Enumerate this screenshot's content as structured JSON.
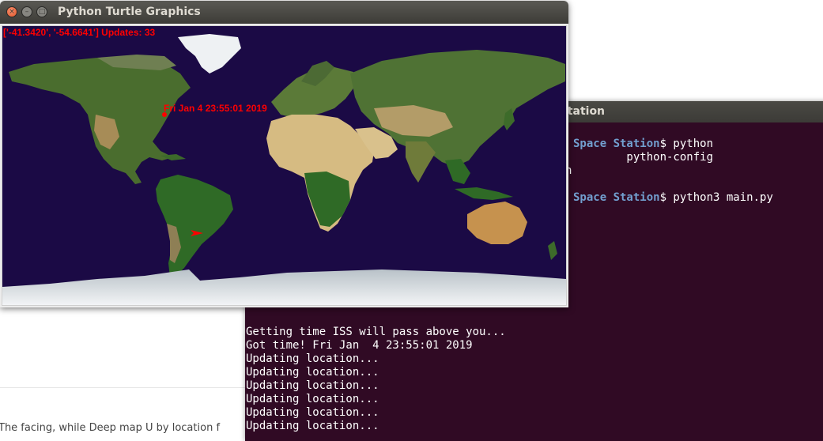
{
  "background_page": {
    "footer_text": "The facing, while Deep map U by location f"
  },
  "terminal": {
    "title": "ional Space Station",
    "lines": {
      "l1_prefix": "Space Station",
      "l1_suffix": "$ python",
      "l2": "        python-config",
      "l3": "n",
      "l4_prefix": "Space Station",
      "l4_suffix": "$ python3 main.py",
      "l5": "Getting time ISS will pass above you...",
      "l6": "Got time! Fri Jan  4 23:55:01 2019",
      "l7": "Updating location...",
      "l8": "Updating location...",
      "l9": "Updating location...",
      "l10": "Updating location...",
      "l11": "Updating location...",
      "l12": "Updating location..."
    }
  },
  "turtle_window": {
    "title": "Python Turtle Graphics",
    "close_glyph": "×",
    "minimize_glyph": "–",
    "maximize_glyph": "□",
    "coords_text": "['-41.3420', '-54.6641'] Updates: 33",
    "pass_time_text": "Fri Jan  4 23:55:01 2019"
  },
  "colors": {
    "ocean": "#1b0a45",
    "land_green": "#3d6b2a",
    "desert": "#c9b07a",
    "ice": "#e8ecef",
    "marker_red": "#ff0000",
    "terminal_bg": "#300a24",
    "prompt_blue": "#729fcf"
  }
}
